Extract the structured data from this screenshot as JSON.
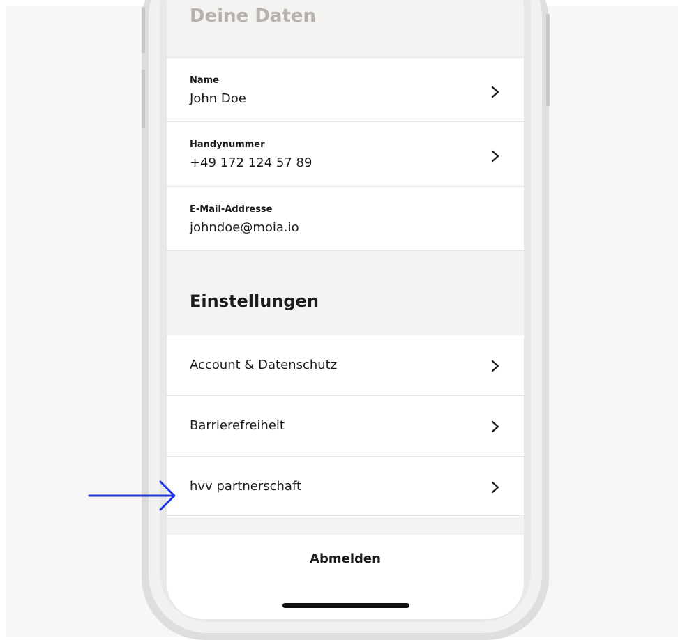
{
  "colors": {
    "page_background": "#f8f7f5",
    "section_background": "#f4f3f1",
    "annotation_arrow": "#1a35e8",
    "text": "#1c1c1c"
  },
  "personal_data": {
    "title": "Deine Daten",
    "fields": [
      {
        "label": "Name",
        "value": "John Doe",
        "has_chevron": true
      },
      {
        "label": "Handynummer",
        "value": "+49 172 124 57 89",
        "has_chevron": true
      },
      {
        "label": "E-Mail-Addresse",
        "value": "johndoe@moia.io",
        "has_chevron": false
      }
    ]
  },
  "settings": {
    "title": "Einstellungen",
    "items": [
      {
        "label": "Account & Datenschutz",
        "icon": "chevron-right-icon"
      },
      {
        "label": "Barrierefreiheit",
        "icon": "chevron-right-icon"
      },
      {
        "label": "hvv partnerschaft",
        "icon": "chevron-right-icon"
      }
    ]
  },
  "logout": {
    "label": "Abmelden"
  },
  "annotation": {
    "icon": "right-arrow-icon",
    "points_to": "hvv partnerschaft"
  }
}
